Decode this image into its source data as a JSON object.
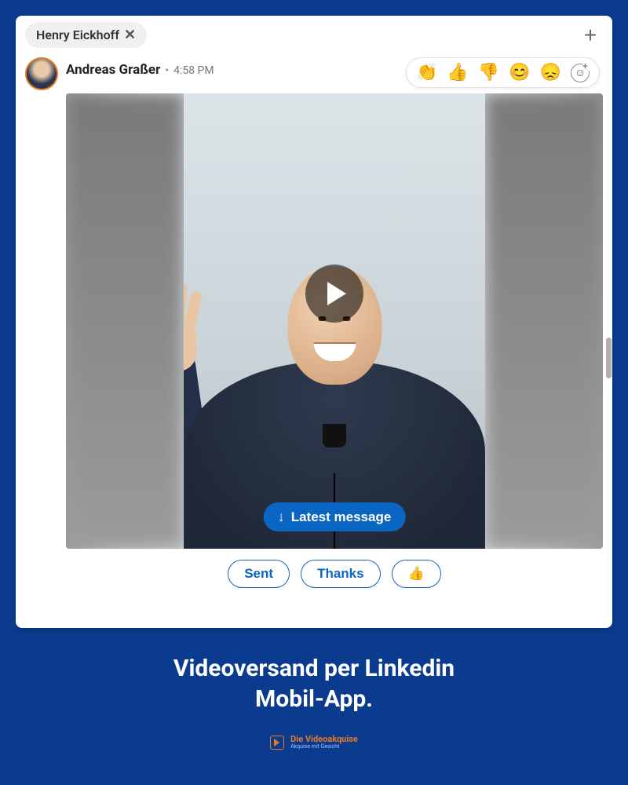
{
  "chat": {
    "recipient_name": "Henry Eickhoff",
    "sender_name": "Andreas Graßer",
    "time_sep": "•",
    "time": "4:58 PM",
    "reactions": [
      "👏",
      "👍",
      "👎",
      "😊",
      "😞"
    ],
    "latest_label": "Latest message",
    "quick_replies": [
      "Sent",
      "Thanks",
      "👍"
    ]
  },
  "caption": {
    "line1": "Videoversand per Linkedin",
    "line2": "Mobil-App."
  },
  "brand": {
    "name": "Die Videoakquise",
    "tagline": "Akquise mit Gesicht"
  }
}
